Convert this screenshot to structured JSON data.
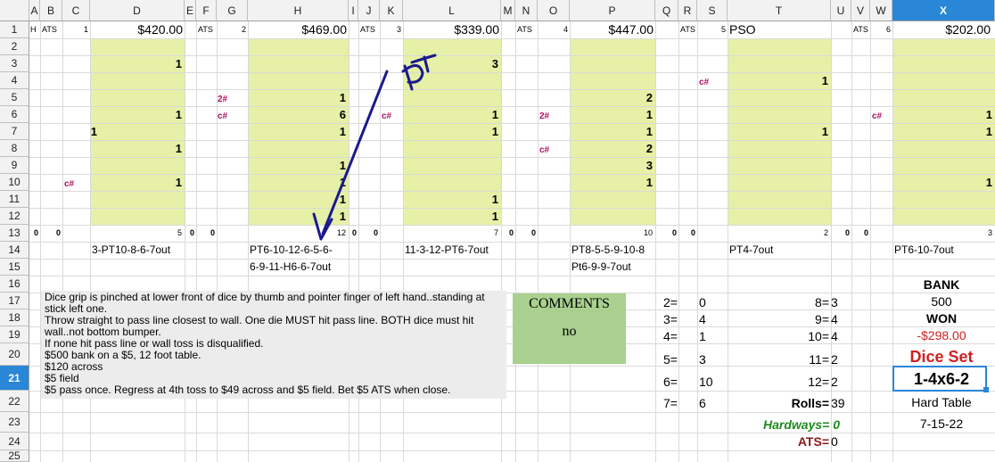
{
  "columns": [
    "A",
    "B",
    "C",
    "D",
    "E",
    "F",
    "G",
    "H",
    "I",
    "J",
    "K",
    "L",
    "M",
    "N",
    "O",
    "P",
    "Q",
    "R",
    "S",
    "T",
    "U",
    "V",
    "W",
    "X"
  ],
  "rows": [
    "1",
    "2",
    "3",
    "4",
    "5",
    "6",
    "7",
    "8",
    "9",
    "10",
    "11",
    "12",
    "13",
    "14",
    "15",
    "16",
    "17",
    "18",
    "19",
    "20",
    "21",
    "22",
    "23",
    "24",
    "25"
  ],
  "selected_cell": {
    "column": "X",
    "row": "21"
  },
  "row1": {
    "a": "H",
    "b": "ATS",
    "c": "1",
    "d": "$420.00",
    "f": "ATS",
    "g": "2",
    "h": "$469.00",
    "j": "ATS",
    "k": "3",
    "l": "$339.00",
    "n": "ATS",
    "o": "4",
    "p": "$447.00",
    "r": "ATS",
    "s": "5",
    "t": "PSO",
    "v": "ATS",
    "w": "6",
    "x": "$202.00"
  },
  "tally": {
    "d": [
      "1",
      "1",
      "1",
      "1",
      "1"
    ],
    "c7": "1",
    "h": [
      "1",
      "1",
      "6",
      "1",
      "1",
      "1",
      "1",
      "1"
    ],
    "l": [
      "3",
      "1",
      "1",
      "1",
      "1"
    ],
    "p": [
      "2",
      "1",
      "1",
      "2",
      "3",
      "1"
    ],
    "t": [
      "1",
      "1"
    ],
    "x": [
      "1",
      "1",
      "1"
    ],
    "c_marks": {
      "c10": "c#",
      "g5": "2#",
      "g6": "c#",
      "k6": "c#",
      "o6": "2#",
      "o8": "c#",
      "s4": "c#",
      "w6": "c#"
    }
  },
  "row13": {
    "a": "0",
    "b": "0",
    "d": "5",
    "e": "0",
    "f": "0",
    "h": "12",
    "i": "0",
    "j": "0",
    "l": "7",
    "m": "0",
    "n": "0",
    "p": "10",
    "q": "0",
    "r": "0",
    "t": "2",
    "u": "0",
    "v": "0",
    "x": "3"
  },
  "row14": {
    "d": "3-PT10-8-6-7out",
    "h": "PT6-10-12-6-5-6-",
    "l": "11-3-12-PT6-7out",
    "p": "PT8-5-5-9-10-8",
    "t": "PT4-7out",
    "x": "PT6-10-7out"
  },
  "row15": {
    "h": "6-9-11-H6-6-7out",
    "p": "Pt6-9-9-7out"
  },
  "notes": [
    "Dice grip is pinched at lower front of dice by thumb and pointer finger of left hand..standing at stick left one.",
    "Throw straight to pass line closest to wall. One die MUST hit pass line. BOTH dice must hit wall..not bottom bumper.",
    "If none hit pass line or wall toss is disqualified.",
    "$500 bank  on a $5, 12 foot table.",
    "$120 across",
    "$5 field",
    "$5 pass once.   Regress at 4th toss to $49 across and $5 field. Bet $5 ATS when close."
  ],
  "comments": {
    "title": "COMMENTS",
    "value": "no"
  },
  "counts_left": [
    {
      "label": "2=",
      "value": "0"
    },
    {
      "label": "3=",
      "value": "4"
    },
    {
      "label": "4=",
      "value": "1"
    },
    {
      "label": "5=",
      "value": "3"
    },
    {
      "label": "6=",
      "value": "10"
    },
    {
      "label": "7=",
      "value": "6"
    }
  ],
  "counts_right": [
    {
      "label": "8=",
      "value": "3"
    },
    {
      "label": "9=",
      "value": "4"
    },
    {
      "label": "10=",
      "value": "4"
    },
    {
      "label": "11=",
      "value": "2"
    },
    {
      "label": "12=",
      "value": "2"
    }
  ],
  "rolls": {
    "label": "Rolls=",
    "value": "39"
  },
  "hardways": {
    "label": "Hardways= 0"
  },
  "ats": {
    "label": "ATS=",
    "value": "0"
  },
  "summary": {
    "bank_label": "BANK",
    "bank": "500",
    "won_label": "WON",
    "won": "-$298.00",
    "dice_set_label": "Dice Set",
    "dice_set": "1-4x6-2",
    "table": "Hard Table",
    "date": "7-15-22"
  },
  "annotation": {
    "text": "PT"
  },
  "colors": {
    "fill": "#e6f0a6",
    "selection": "#2a86d6",
    "won_negative": "#d02020",
    "dice_set": "#d02020",
    "hardways": "#1e8a1e",
    "ats": "#8b1a1a",
    "comments_bg": "#a9d08e",
    "pen": "#1a1a8c"
  }
}
